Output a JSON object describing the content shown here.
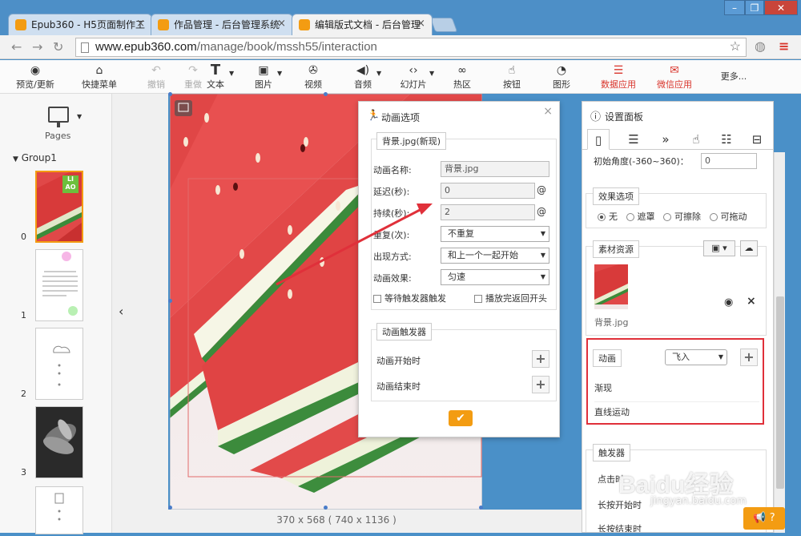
{
  "browser": {
    "tabs": [
      {
        "label": "Epub360 - H5页面制作工"
      },
      {
        "label": "作品管理 - 后台管理系统"
      },
      {
        "label": "编辑版式文档 - 后台管理"
      }
    ],
    "url_domain": "www.epub360.com",
    "url_path": "/manage/book/mssh55/interaction"
  },
  "toolbar": {
    "items": [
      {
        "label": "预览/更新",
        "icon": "eye-icon"
      },
      {
        "label": "快捷菜单",
        "icon": "home-icon"
      },
      {
        "label": "撤销",
        "icon": "undo-icon",
        "disabled": true
      },
      {
        "label": "重做",
        "icon": "redo-icon",
        "disabled": true
      },
      {
        "label": "文本",
        "icon": "text-icon"
      },
      {
        "label": "图片",
        "icon": "image-icon"
      },
      {
        "label": "视频",
        "icon": "film-icon"
      },
      {
        "label": "音频",
        "icon": "audio-icon"
      },
      {
        "label": "幻灯片",
        "icon": "code-icon"
      },
      {
        "label": "热区",
        "icon": "link-icon"
      },
      {
        "label": "按钮",
        "icon": "pointer-icon"
      },
      {
        "label": "图形",
        "icon": "shape-icon"
      },
      {
        "label": "数据应用",
        "icon": "database-icon"
      },
      {
        "label": "微信应用",
        "icon": "chat-icon"
      },
      {
        "label": "更多..."
      }
    ]
  },
  "left": {
    "pages_label": "Pages",
    "group_label": "Group1",
    "thumbs": [
      {
        "num": "0",
        "badge": "LI AO"
      },
      {
        "num": "1"
      },
      {
        "num": "2"
      },
      {
        "num": "3"
      }
    ]
  },
  "canvas": {
    "size_label": "370 x 568 ( 740 x 1136 )"
  },
  "anim_dialog": {
    "title": "动画选项",
    "group1_title": "背景.jpg(新现)",
    "name_label": "动画名称:",
    "name_value": "背景.jpg",
    "delay_label": "延迟(秒):",
    "delay_value": "0",
    "duration_label": "持续(秒):",
    "duration_value": "2",
    "repeat_label": "重复(次):",
    "repeat_value": "不重复",
    "appear_label": "出现方式:",
    "appear_value": "和上一个一起开始",
    "effect_label": "动画效果:",
    "effect_value": "匀速",
    "wait_trigger": "等待触发器触发",
    "play_back": "播放完返回开头",
    "group2_title": "动画触发器",
    "trigger_start": "动画开始时",
    "trigger_end": "动画结束时",
    "at_symbol": "@"
  },
  "settings": {
    "title": "设置面板",
    "initial_angle_label": "初始角度(-360~360)：",
    "initial_angle_value": "0",
    "effect_title": "效果选项",
    "effect_options": [
      "无",
      "遮罩",
      "可擦除",
      "可拖动"
    ],
    "assets_title": "素材资源",
    "asset_name": "背景.jpg",
    "anim_title": "动画",
    "anim_select": "飞入",
    "anim_items": [
      "渐现",
      "直线运动"
    ],
    "trigger_title": "触发器",
    "trigger_items": [
      "点击时",
      "长按开始时",
      "长按结束时"
    ]
  },
  "watermark": {
    "text": "Baidu经验",
    "sub": "jingyan.baidu.com"
  },
  "help": {
    "label": "?"
  },
  "colors": {
    "accent": "#f39c12",
    "red": "#d9342b",
    "highlight": "#e0303a"
  }
}
